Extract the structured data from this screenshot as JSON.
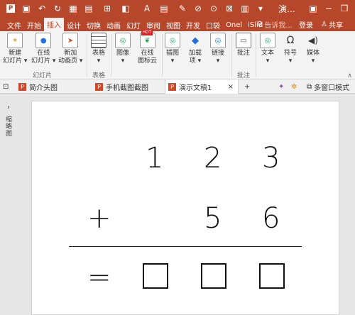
{
  "titlebar": {
    "title": "演...",
    "qa_icons": [
      "file-save-icon",
      "undo-icon",
      "redo-icon",
      "grid-icon",
      "layout-icon",
      "format-icon",
      "shape-icon",
      "text-a-icon",
      "clipboard-icon",
      "brush-icon",
      "eraser-icon",
      "pin-icon",
      "cube-icon",
      "note-icon",
      "dropdown-icon"
    ]
  },
  "tabs": [
    {
      "label": "文件"
    },
    {
      "label": "开始"
    },
    {
      "label": "插入"
    },
    {
      "label": "设计"
    },
    {
      "label": "切换"
    },
    {
      "label": "动画"
    },
    {
      "label": "幻灯"
    },
    {
      "label": "审阅"
    },
    {
      "label": "视图"
    },
    {
      "label": "开发"
    },
    {
      "label": "口袋"
    },
    {
      "label": "Onel"
    },
    {
      "label": "iSlid"
    }
  ],
  "tab_right": {
    "tell_me": "告诉我...",
    "login": "登录",
    "share": "共享"
  },
  "ribbon": {
    "new_slide": "新建\n幻灯片",
    "online_slide": "在线\n幻灯片",
    "new_anim_page": "新加\n动画页",
    "table": "表格",
    "image": "图像",
    "online_icon": "在线\n图标云",
    "illustration": "插图",
    "addins": "加载\n项",
    "link": "链接",
    "comment": "批注",
    "text": "文本",
    "symbol": "符号",
    "media": "媒体",
    "group_slides": "幻灯片",
    "group_table": "表格",
    "group_comment": "批注",
    "hot_badge": "HOT"
  },
  "doc_tabs": [
    {
      "label": "简介头图",
      "active": false
    },
    {
      "label": "手机截图截图",
      "active": false
    },
    {
      "label": "演示文稿1",
      "active": true
    }
  ],
  "docbar_right": {
    "add": "+",
    "multi_window": "多窗口模式"
  },
  "left_pane": {
    "label": "缩略图"
  },
  "slide": {
    "row1": [
      "1",
      "2",
      "3"
    ],
    "row2_op": "+",
    "row2": [
      "5",
      "6"
    ],
    "eq": "="
  }
}
